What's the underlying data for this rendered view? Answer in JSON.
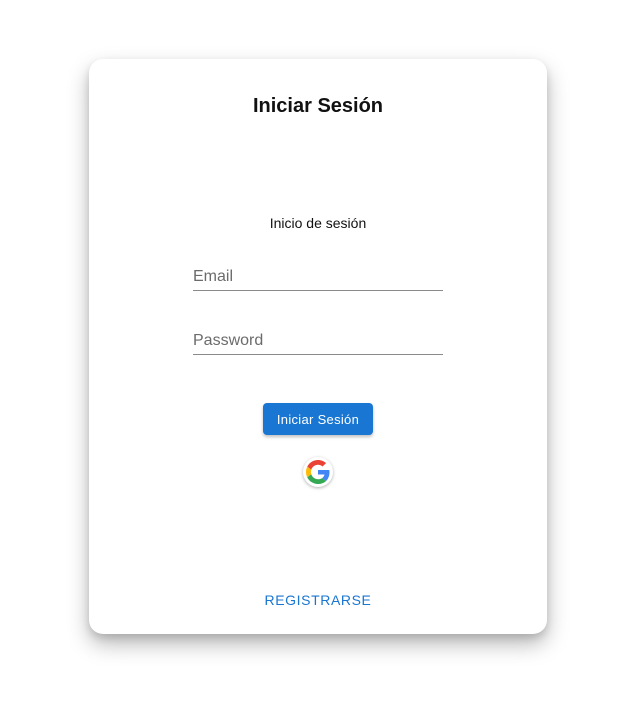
{
  "login": {
    "title": "Iniciar Sesión",
    "subtitle": "Inicio de sesión",
    "email": {
      "placeholder": "Email",
      "value": ""
    },
    "password": {
      "placeholder": "Password",
      "value": ""
    },
    "submit_label": "Iniciar Sesión",
    "google_icon": "google-g-icon",
    "register_label": "REGISTRARSE"
  },
  "colors": {
    "primary": "#1976d2",
    "background": "#ffffff"
  }
}
